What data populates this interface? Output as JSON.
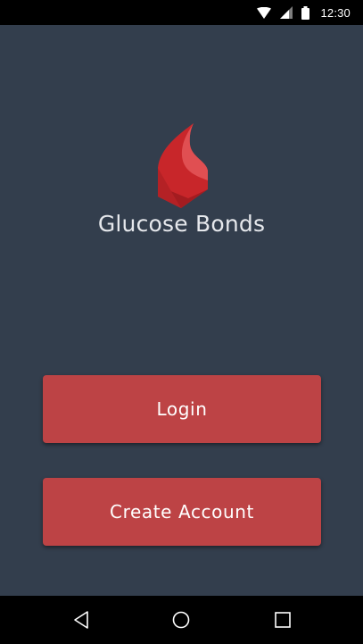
{
  "status_bar": {
    "time": "12:30",
    "icons": [
      "wifi-icon",
      "cell-signal-icon",
      "battery-icon"
    ]
  },
  "app": {
    "title": "Glucose Bonds",
    "logo_icon": "blood-drop-icon",
    "accent_color": "#bd4345",
    "background_color": "#333e4d"
  },
  "buttons": {
    "login_label": "Login",
    "create_account_label": "Create Account"
  },
  "nav_bar": {
    "icons": [
      "back-icon",
      "home-icon",
      "recents-icon"
    ]
  }
}
